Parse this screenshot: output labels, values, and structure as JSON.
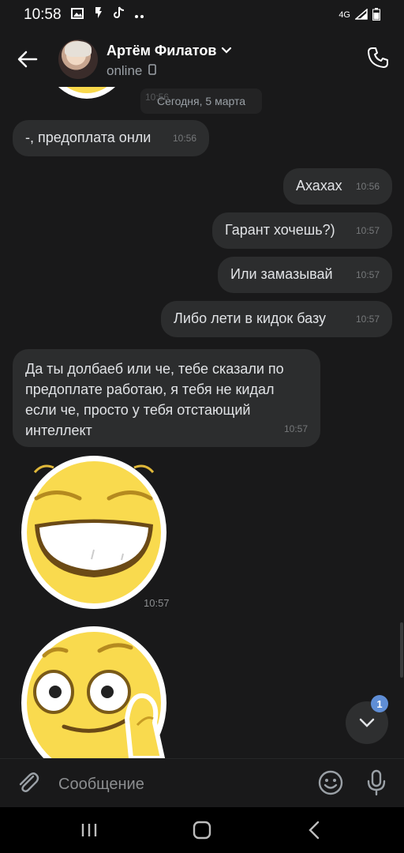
{
  "status_bar": {
    "time": "10:58",
    "network": "4G",
    "icons": [
      "gallery-icon",
      "bolt-icon",
      "tiktok-icon",
      "more-dots-icon",
      "signal-icon",
      "battery-icon"
    ]
  },
  "header": {
    "contact_name": "Артём Филатов",
    "status": "online",
    "icons": [
      "back-arrow-icon",
      "chevron-down-icon",
      "phone-device-icon",
      "call-icon"
    ]
  },
  "chat": {
    "date_pill": "Сегодня, 5 марта",
    "date_pill_ghost_time": "10:56",
    "messages": [
      {
        "side": "in",
        "text": "-, предоплата онли",
        "time": "10:56"
      },
      {
        "side": "out",
        "text": "Ахахах",
        "time": "10:56"
      },
      {
        "side": "out",
        "text": "Гарант хочешь?)",
        "time": "10:57"
      },
      {
        "side": "out",
        "text": "Или замазывай",
        "time": "10:57"
      },
      {
        "side": "out",
        "text": "Либо лети в кидок базу",
        "time": "10:57"
      },
      {
        "side": "in",
        "text": "Да ты долбаеб или че, тебе сказали по предоплате работаю, я тебя не кидал если че, просто у тебя отстающий интеллект",
        "time": "10:57"
      }
    ],
    "stickers": [
      {
        "name": "grinning-sticker",
        "time": "10:57"
      },
      {
        "name": "thumb-chin-sticker",
        "time": ""
      }
    ],
    "unread_count": "1"
  },
  "composer": {
    "placeholder": "Сообщение",
    "icons": [
      "paperclip-icon",
      "emoji-icon",
      "microphone-icon"
    ]
  },
  "nav": {
    "icons": [
      "recents-icon",
      "home-icon",
      "back-icon"
    ]
  },
  "colors": {
    "background": "#19191a",
    "bubble": "#2c2d2e",
    "accent_badge": "#5f8ed6"
  }
}
